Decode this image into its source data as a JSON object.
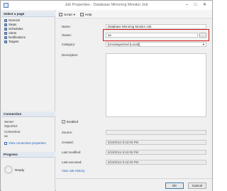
{
  "window": {
    "title": "Job Properties - Database Mirroring Monitor Job",
    "minimize": "–",
    "maximize": "□",
    "close": "✕"
  },
  "sidebar": {
    "select_page_header": "Select a page",
    "pages": [
      {
        "label": "General",
        "icon": "page-icon"
      },
      {
        "label": "Steps",
        "icon": "page-icon"
      },
      {
        "label": "Schedules",
        "icon": "page-icon"
      },
      {
        "label": "Alerts",
        "icon": "page-icon"
      },
      {
        "label": "Notifications",
        "icon": "page-icon"
      },
      {
        "label": "Targets",
        "icon": "page-icon"
      }
    ],
    "connection_header": "Connection",
    "server_label": "Server:",
    "server_value": "SQL2012",
    "connection_label": "Connection:",
    "connection_value": "sa",
    "view_connection_link": "View connection properties",
    "progress_header": "Progress",
    "progress_status": "Ready"
  },
  "toolbar": {
    "script_label": "Script",
    "help_label": "Help"
  },
  "form": {
    "name_label": "Name:",
    "name_value": "Database Mirroring Monitor Job",
    "owner_label": "Owner:",
    "owner_value": "sa",
    "owner_browse": "...",
    "category_label": "Category:",
    "category_value": "[Uncategorized (Local)]",
    "description_label": "Description:",
    "enabled_label": "Enabled",
    "enabled_checked": "✓",
    "source_label": "Source:",
    "source_value": "",
    "created_label": "Created:",
    "created_value": "5/19/2014 8:42:00 PM",
    "last_modified_label": "Last modified:",
    "last_modified_value": "5/19/2014 8:42:05 PM",
    "last_executed_label": "Last executed:",
    "last_executed_value": "5/19/2014 9:42:00 PM",
    "view_job_history": "View Job History"
  },
  "buttons": {
    "ok": "OK",
    "cancel": "Cancel"
  },
  "colors": {
    "highlight": "#d61a1a",
    "link": "#1f5fbf"
  }
}
